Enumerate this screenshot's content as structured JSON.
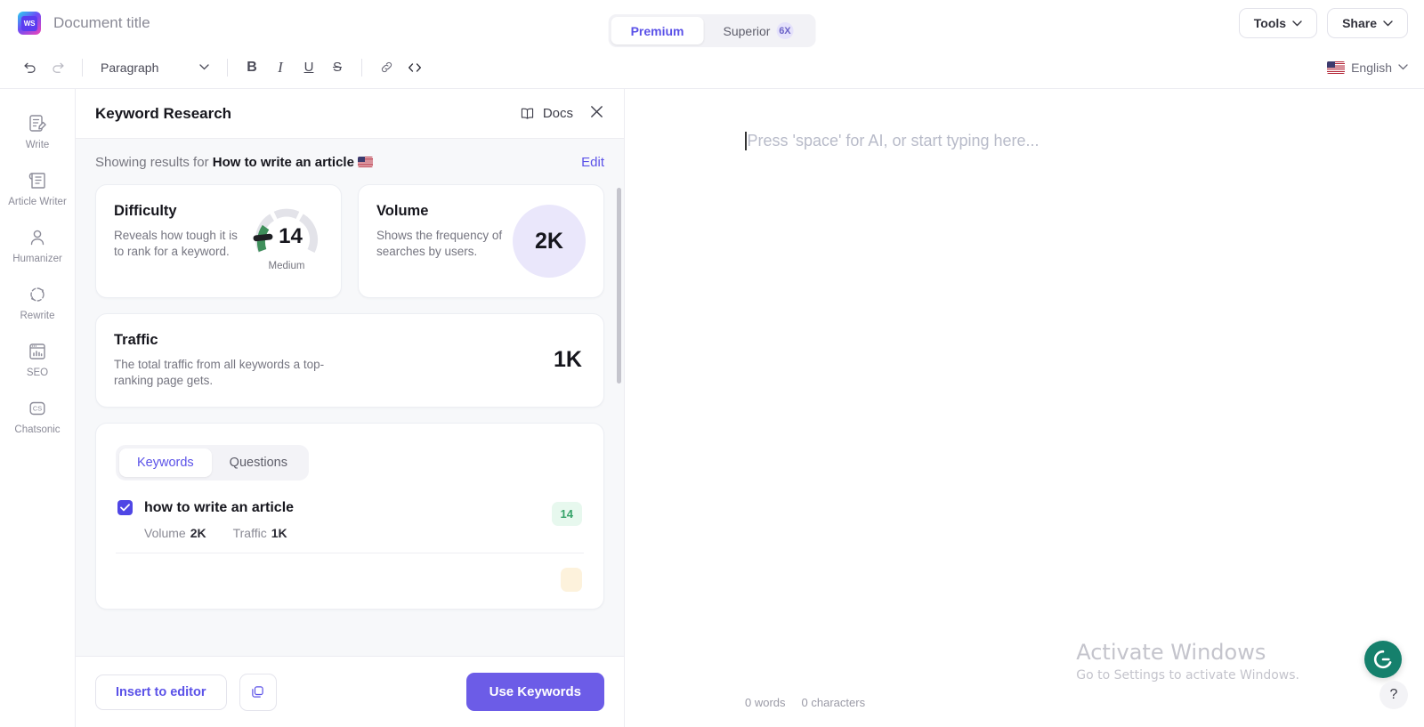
{
  "topbar": {
    "logo_text": "WS",
    "doc_title": "Document title",
    "tabs": [
      {
        "label": "Premium",
        "badge": "",
        "active": true
      },
      {
        "label": "Superior",
        "badge": "6X",
        "active": false
      }
    ],
    "tools_label": "Tools",
    "share_label": "Share"
  },
  "formatbar": {
    "undo_icon": "undo-icon",
    "redo_icon": "redo-icon",
    "style_value": "Paragraph",
    "bold": "B",
    "italic": "I",
    "underline": "U",
    "strikethrough": "S",
    "link_icon": "link-icon",
    "code_icon": "code-icon",
    "language": "English"
  },
  "sidebar": {
    "items": [
      {
        "label": "Write",
        "icon": "write-icon"
      },
      {
        "label": "Article Writer",
        "icon": "article-writer-icon"
      },
      {
        "label": "Humanizer",
        "icon": "humanizer-icon"
      },
      {
        "label": "Rewrite",
        "icon": "rewrite-icon"
      },
      {
        "label": "SEO",
        "icon": "seo-icon"
      },
      {
        "label": "Chatsonic",
        "icon": "chatsonic-icon"
      }
    ]
  },
  "panel": {
    "title": "Keyword Research",
    "docs_label": "Docs",
    "showing_prefix": "Showing results for",
    "showing_keyword": "How to write an article",
    "showing_flag": "us-flag",
    "edit_label": "Edit",
    "stats": {
      "difficulty": {
        "title": "Difficulty",
        "desc": "Reveals how tough it is to rank for a keyword.",
        "value": "14",
        "level": "Medium",
        "gauge_color": "#3f8f5b",
        "track_color": "#e3e3e9"
      },
      "volume": {
        "title": "Volume",
        "desc": "Shows the frequency of searches by users.",
        "value": "2K",
        "bubble_color": "#eae7fb"
      },
      "traffic": {
        "title": "Traffic",
        "desc": "The total traffic from all keywords a top-ranking page gets.",
        "value": "1K"
      }
    },
    "tabs": [
      {
        "label": "Keywords",
        "active": true
      },
      {
        "label": "Questions",
        "active": false
      }
    ],
    "keyword_columns": {
      "volume_label": "Volume",
      "traffic_label": "Traffic"
    },
    "keywords": [
      {
        "name": "how to write an article",
        "checked": true,
        "volume": "2K",
        "traffic": "1K",
        "difficulty": "14",
        "difficulty_color": "#37a46a"
      }
    ],
    "footer": {
      "insert_label": "Insert to editor",
      "copy_icon": "copy-icon",
      "use_keywords_label": "Use Keywords"
    }
  },
  "editor": {
    "placeholder": "Press 'space' for AI, or start typing here...",
    "words": "0 words",
    "characters": "0 characters"
  },
  "overlay": {
    "activate_title": "Activate Windows",
    "activate_sub": "Go to Settings to activate Windows.",
    "grammarly_icon": "grammarly-icon",
    "help_label": "?"
  }
}
